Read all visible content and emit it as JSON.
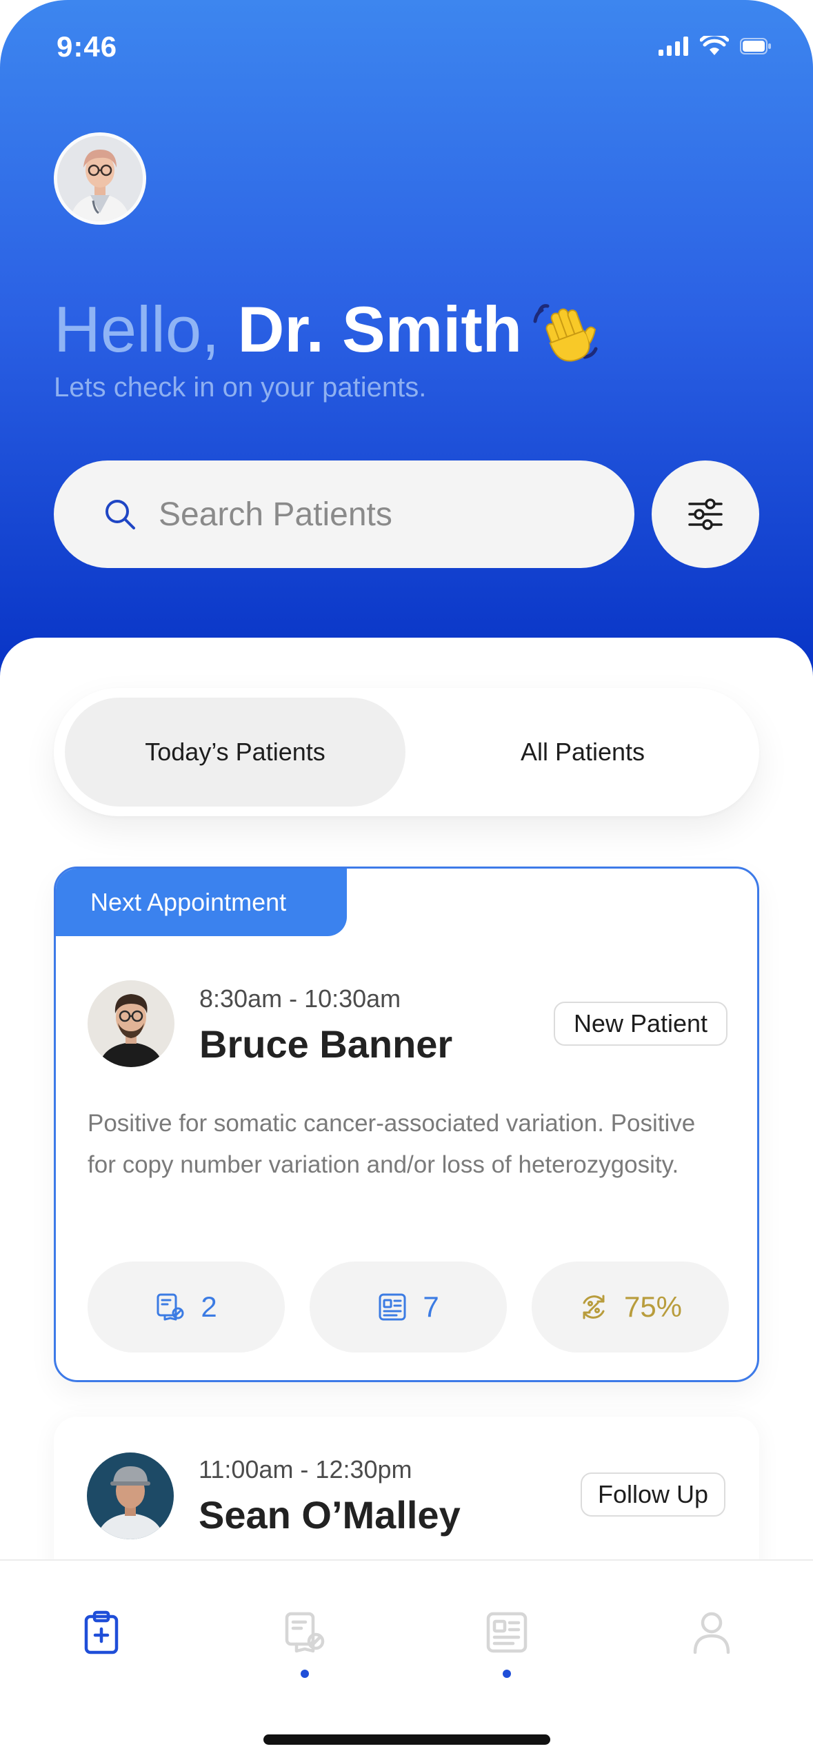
{
  "status_bar": {
    "time": "9:46"
  },
  "header": {
    "greeting": "Hello,",
    "doctor_name": "Dr. Smith",
    "wave_emoji": "👋",
    "subtitle": "Lets check in on your patients."
  },
  "search": {
    "placeholder": "Search Patients"
  },
  "icons": {
    "search": "search-icon",
    "filter": "sliders-icon",
    "prescriptions": "prescription-icon",
    "reports": "report-icon",
    "progress": "percent-cycle-icon",
    "nav_home": "clipboard-plus-icon",
    "nav_prescriptions": "prescription-icon",
    "nav_reports": "report-icon",
    "nav_profile": "user-icon"
  },
  "tabs": [
    {
      "label": "Today’s Patients",
      "active": true
    },
    {
      "label": "All Patients",
      "active": false
    }
  ],
  "appointments": [
    {
      "tag": "Next Appointment",
      "time": "8:30am - 10:30am",
      "name": "Bruce Banner",
      "badge": "New Patient",
      "description": "Positive for somatic cancer-associated variation. Positive for copy number variation and/or loss of heterozygosity.",
      "stats": {
        "prescriptions": "2",
        "reports": "7",
        "progress": "75%"
      }
    },
    {
      "time": "11:00am - 12:30pm",
      "name": "Sean O’Malley",
      "badge": "Follow Up"
    }
  ],
  "colors": {
    "header_gradient_top": "#3d86ef",
    "header_gradient_bottom": "#0631c4",
    "accent_blue": "#3b82ee",
    "stat_blue": "#3b7be3",
    "progress_gold": "#b89c3c",
    "nav_active": "#1f4ed8",
    "nav_inactive": "#d6d6d6"
  }
}
